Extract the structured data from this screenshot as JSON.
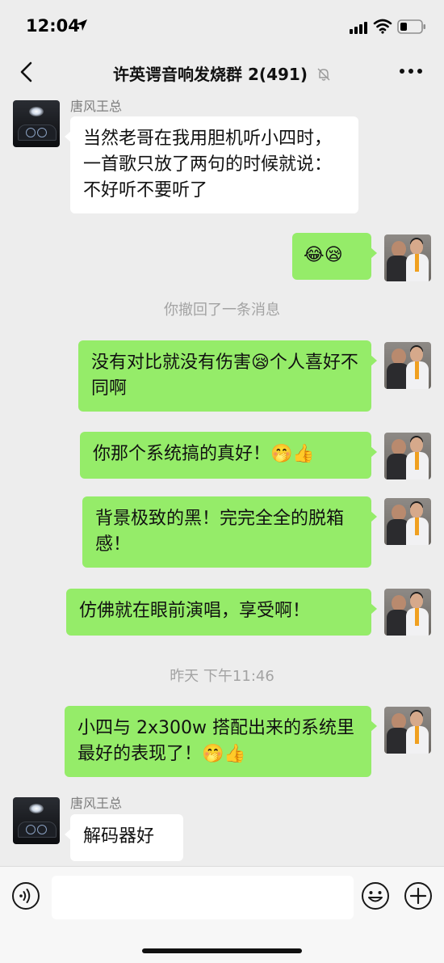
{
  "status_bar": {
    "time": "12:04"
  },
  "header": {
    "title": "许英谔音响发烧群 2(491)"
  },
  "messages": [
    {
      "sender": "唐风王总",
      "text": "当然老哥在我用胆机听小四时，一首歌只放了两句的时候就说：不好听不要听了"
    },
    {
      "text": "😂😪"
    },
    {
      "system": "你撤回了一条消息"
    },
    {
      "text": "没有对比就没有伤害😪个人喜好不同啊"
    },
    {
      "text": "你那个系统搞的真好！🤭👍"
    },
    {
      "text": "背景极致的黑！完完全全的脱箱感！"
    },
    {
      "text": "仿佛就在眼前演唱，享受啊！"
    },
    {
      "system": "昨天 下午11:46"
    },
    {
      "text": "小四与 2x300w 搭配出来的系统里最好的表现了！🤭👍"
    },
    {
      "sender": "唐风王总",
      "text": "解码器好"
    }
  ],
  "input": {
    "value": ""
  },
  "colors": {
    "background": "#ededed",
    "outgoing_bubble": "#95ec69",
    "incoming_bubble": "#ffffff",
    "input_bar": "#f7f7f7"
  },
  "icons": [
    "location-arrow-icon",
    "signal-icon",
    "wifi-icon",
    "battery-icon",
    "back-icon",
    "mute-bell-icon",
    "more-icon",
    "voice-icon",
    "emoji-icon",
    "plus-icon"
  ]
}
